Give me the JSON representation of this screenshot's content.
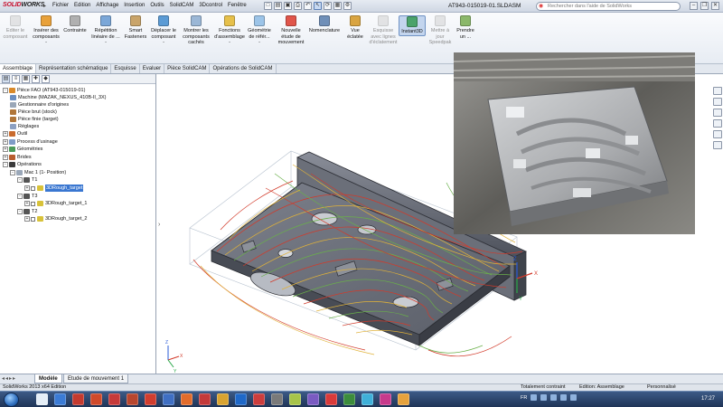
{
  "app": {
    "logo_prefix": "SOLID",
    "logo_suffix": "WORKS",
    "document_title": "AT943-015019-01.SLDASM",
    "help_search_placeholder": "Rechercher dans l'aide de SolidWorks"
  },
  "menu": [
    "Fichier",
    "Edition",
    "Affichage",
    "Insertion",
    "Outils",
    "SolidCAM",
    "3Dcontrol",
    "Fenêtre"
  ],
  "ribbon": [
    {
      "label": "Editer le\ncomposant",
      "disabled": true,
      "icon": "edit-component-icon",
      "color": "#c9c9c9"
    },
    {
      "label": "Insérer des\ncomposants\n-",
      "icon": "insert-components-icon",
      "color": "#e8a13a"
    },
    {
      "label": "Contrainte",
      "icon": "mate-icon",
      "color": "#b0b0b0"
    },
    {
      "label": "Répétition\nlinéaire de ...\n-",
      "icon": "linear-pattern-icon",
      "color": "#7ba7d8"
    },
    {
      "label": "Smart\nFasteners",
      "icon": "smart-fasteners-icon",
      "color": "#c9a46a"
    },
    {
      "label": "Déplacer le\ncomposant\n-",
      "icon": "move-component-icon",
      "color": "#5b9bd5"
    },
    {
      "label": "Montrer les\ncomposants\ncachés",
      "icon": "show-hidden-icon",
      "color": "#9bb7d6"
    },
    {
      "label": "Fonctions\nd'assemblage\n-",
      "icon": "assembly-features-icon",
      "color": "#e6c04b"
    },
    {
      "label": "Géométrie\nde référ...\n-",
      "icon": "reference-geometry-icon",
      "color": "#9cc4e8"
    },
    {
      "label": "Nouvelle\nétude de\nmouvement",
      "icon": "motion-study-icon",
      "color": "#e0554a"
    },
    {
      "label": "Nomenclature",
      "icon": "bom-icon",
      "color": "#6f8fb8"
    },
    {
      "label": "Vue\néclatée",
      "icon": "exploded-view-icon",
      "color": "#d9a441"
    },
    {
      "label": "Esquisse\navec lignes\nd'éclatement",
      "disabled": true,
      "icon": "explode-line-icon",
      "color": "#c9c9c9"
    },
    {
      "label": "Instant3D",
      "active": true,
      "icon": "instant3d-icon",
      "color": "#4aa36b"
    },
    {
      "label": "Mettre à\njour\nSpeedpak",
      "disabled": true,
      "icon": "speedpak-icon",
      "color": "#c9c9c9"
    },
    {
      "label": "Prendre\nun ...",
      "icon": "snapshot-icon",
      "color": "#8bb86a"
    }
  ],
  "command_tabs": [
    "Assemblage",
    "Représentation schématique",
    "Esquisse",
    "Evaluer",
    "Pièce SolidCAM",
    "Opérations de SolidCAM"
  ],
  "tree": [
    {
      "label": "Pièce FAO (AT943-015019-01)",
      "indent": 0,
      "expander": "-",
      "icon_color": "#d98a2b"
    },
    {
      "label": "Machine (MAZAK_NEXUS_410B-II_3X)",
      "indent": 1,
      "icon_color": "#6b8fc2"
    },
    {
      "label": "Gestionnaire d'origines",
      "indent": 1,
      "icon_color": "#9aa7b8"
    },
    {
      "label": "Pièce brut (stock)",
      "indent": 1,
      "icon_color": "#b0763a"
    },
    {
      "label": "Pièce finie (target)",
      "indent": 1,
      "icon_color": "#b0763a"
    },
    {
      "label": "Réglages",
      "indent": 1,
      "icon_color": "#8ca0c2"
    },
    {
      "label": "Outil",
      "indent": 0,
      "expander": "+",
      "icon_color": "#c96b2e"
    },
    {
      "label": "Process d'usinage",
      "indent": 0,
      "expander": "+",
      "icon_color": "#7f9cc7"
    },
    {
      "label": "Géométries",
      "indent": 0,
      "expander": "+",
      "icon_color": "#4c9b5a"
    },
    {
      "label": "Brides",
      "indent": 0,
      "expander": "+",
      "icon_color": "#b85d2e"
    },
    {
      "label": "Opérations",
      "indent": 0,
      "expander": "-",
      "icon_color": "#3a3a3a"
    },
    {
      "label": "Mac 1 (1- Position)",
      "indent": 1,
      "expander": "-",
      "icon_color": "#9aa7b8"
    },
    {
      "label": "T1",
      "indent": 2,
      "expander": "-",
      "icon_color": "#555555"
    },
    {
      "label": "3DRough_target",
      "indent": 3,
      "expander": "+",
      "check": true,
      "selected": true,
      "icon_color": "#d8c23a"
    },
    {
      "label": "T3",
      "indent": 2,
      "expander": "-",
      "icon_color": "#555555"
    },
    {
      "label": "3DRough_target_1",
      "indent": 3,
      "expander": "+",
      "check": true,
      "icon_color": "#d8c23a"
    },
    {
      "label": "T2",
      "indent": 2,
      "expander": "-",
      "icon_color": "#555555"
    },
    {
      "label": "3DRough_target_2",
      "indent": 3,
      "expander": "+",
      "check": true,
      "icon_color": "#d8c23a"
    }
  ],
  "axis": {
    "x": "X",
    "y": "Y",
    "z": "Z"
  },
  "bottom_tabs": [
    "Modèle",
    "Etude de mouvement 1"
  ],
  "status": {
    "left": "SolidWorks 2013 x64 Edition",
    "constraint": "Totalement contraint",
    "mode": "Edition: Assemblage",
    "custom": "Personnalisé"
  },
  "taskbar": {
    "language": "FR",
    "time": "17:27",
    "apps": [
      "#e5eef7",
      "#3b7bd5",
      "#c43a2f",
      "#d04a2b",
      "#c63a3a",
      "#b8462e",
      "#d13d2e",
      "#3f6fc3",
      "#e26c2c",
      "#c43a3a",
      "#d9a330",
      "#1f68c8",
      "#cc3d3d",
      "#7a7a7a",
      "#a7c44a",
      "#7a5bc2",
      "#d93a3a",
      "#3c8c3c",
      "#3fb0d9",
      "#c73a8c",
      "#e6a23c"
    ]
  }
}
